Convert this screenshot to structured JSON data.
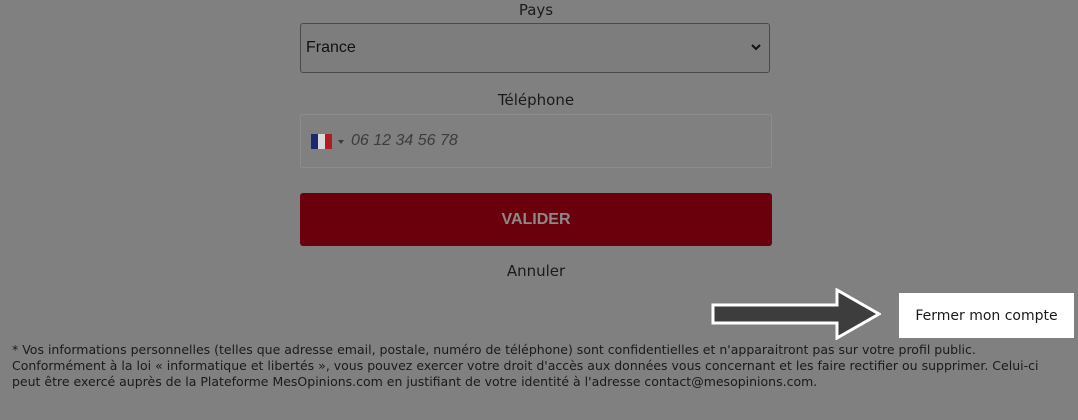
{
  "form": {
    "country_label": "Pays",
    "country_value": "France",
    "phone_label": "Téléphone",
    "phone_placeholder": "06 12 34 56 78",
    "phone_country_flag": "fr-flag-icon",
    "submit_label": "VALIDER",
    "cancel_label": "Annuler"
  },
  "tooltip": {
    "text": "Fermer mon compte"
  },
  "disclaimer": {
    "text": "* Vos informations personnelles (telles que adresse email, postale, numéro de téléphone) sont confidentielles et n'apparaitront pas sur votre profil public. Conformément à la loi « informatique et libertés », vous pouvez exercer votre droit d'accès aux données vous concernant et les faire rectifier ou supprimer. Celui-ci peut être exercé auprès de la Plateforme MesOpinions.com en justifiant de votre identité à l'adresse contact@mesopinions.com."
  },
  "colors": {
    "overlay_bg": "#808080",
    "submit_bg": "#6a000b",
    "tooltip_bg": "#ffffff"
  }
}
